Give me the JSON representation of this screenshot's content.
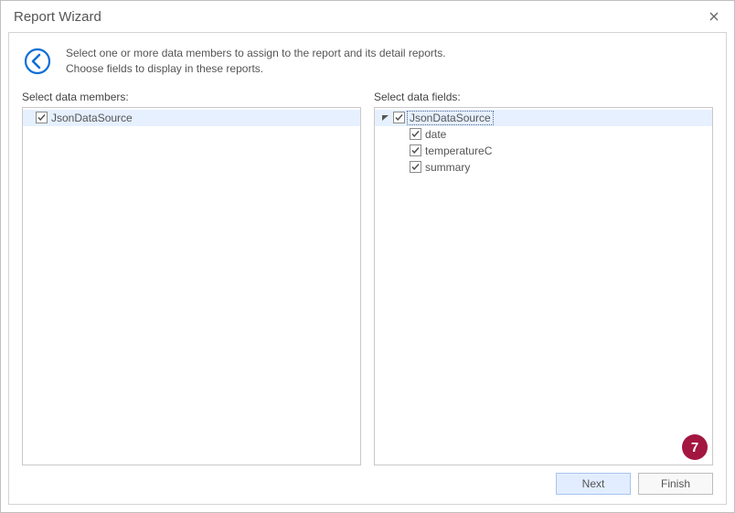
{
  "window": {
    "title": "Report Wizard"
  },
  "header": {
    "line1": "Select one or more data members to assign to the report and its detail reports.",
    "line2": "Choose fields to display in these reports."
  },
  "left": {
    "label": "Select data members:",
    "items": [
      {
        "label": "JsonDataSource",
        "checked": true,
        "selected": true
      }
    ]
  },
  "right": {
    "label": "Select data fields:",
    "root": {
      "label": "JsonDataSource",
      "expanded": true,
      "checked": true,
      "selected": true,
      "children": [
        {
          "label": "date",
          "checked": true
        },
        {
          "label": "temperatureC",
          "checked": true
        },
        {
          "label": "summary",
          "checked": true
        }
      ]
    }
  },
  "footer": {
    "next": "Next",
    "finish": "Finish"
  },
  "callout": "7",
  "colors": {
    "accent": "#0e6fd6",
    "selection": "#e6f0ff",
    "callout": "#a31640"
  }
}
